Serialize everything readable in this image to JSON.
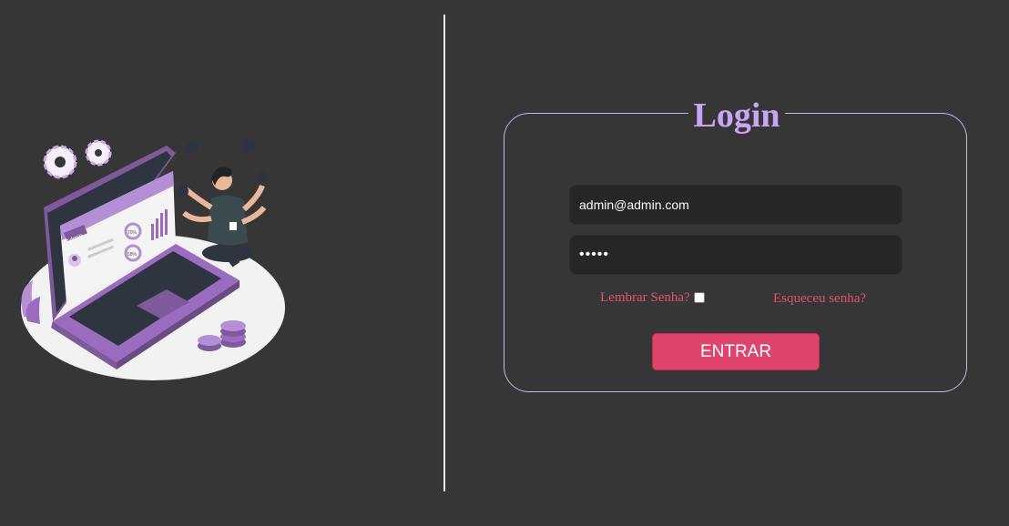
{
  "login": {
    "title": "Login",
    "email_value": "admin@admin.com",
    "password_value": "admin",
    "remember_label": "Lembrar Senha?",
    "remember_checked": false,
    "forgot_label": "Esqueceu senha?",
    "submit_label": "ENTRAR"
  },
  "illustration": {
    "screen_label": "Admin",
    "chart_percent_1": "70%",
    "chart_percent_2": "58%"
  },
  "colors": {
    "background": "#363636",
    "accent_title": "#c9a5f5",
    "link": "#e0546e",
    "button": "#e0446c",
    "box_border": "#c9b6e6",
    "illustration_purple": "#9b6bc0"
  }
}
